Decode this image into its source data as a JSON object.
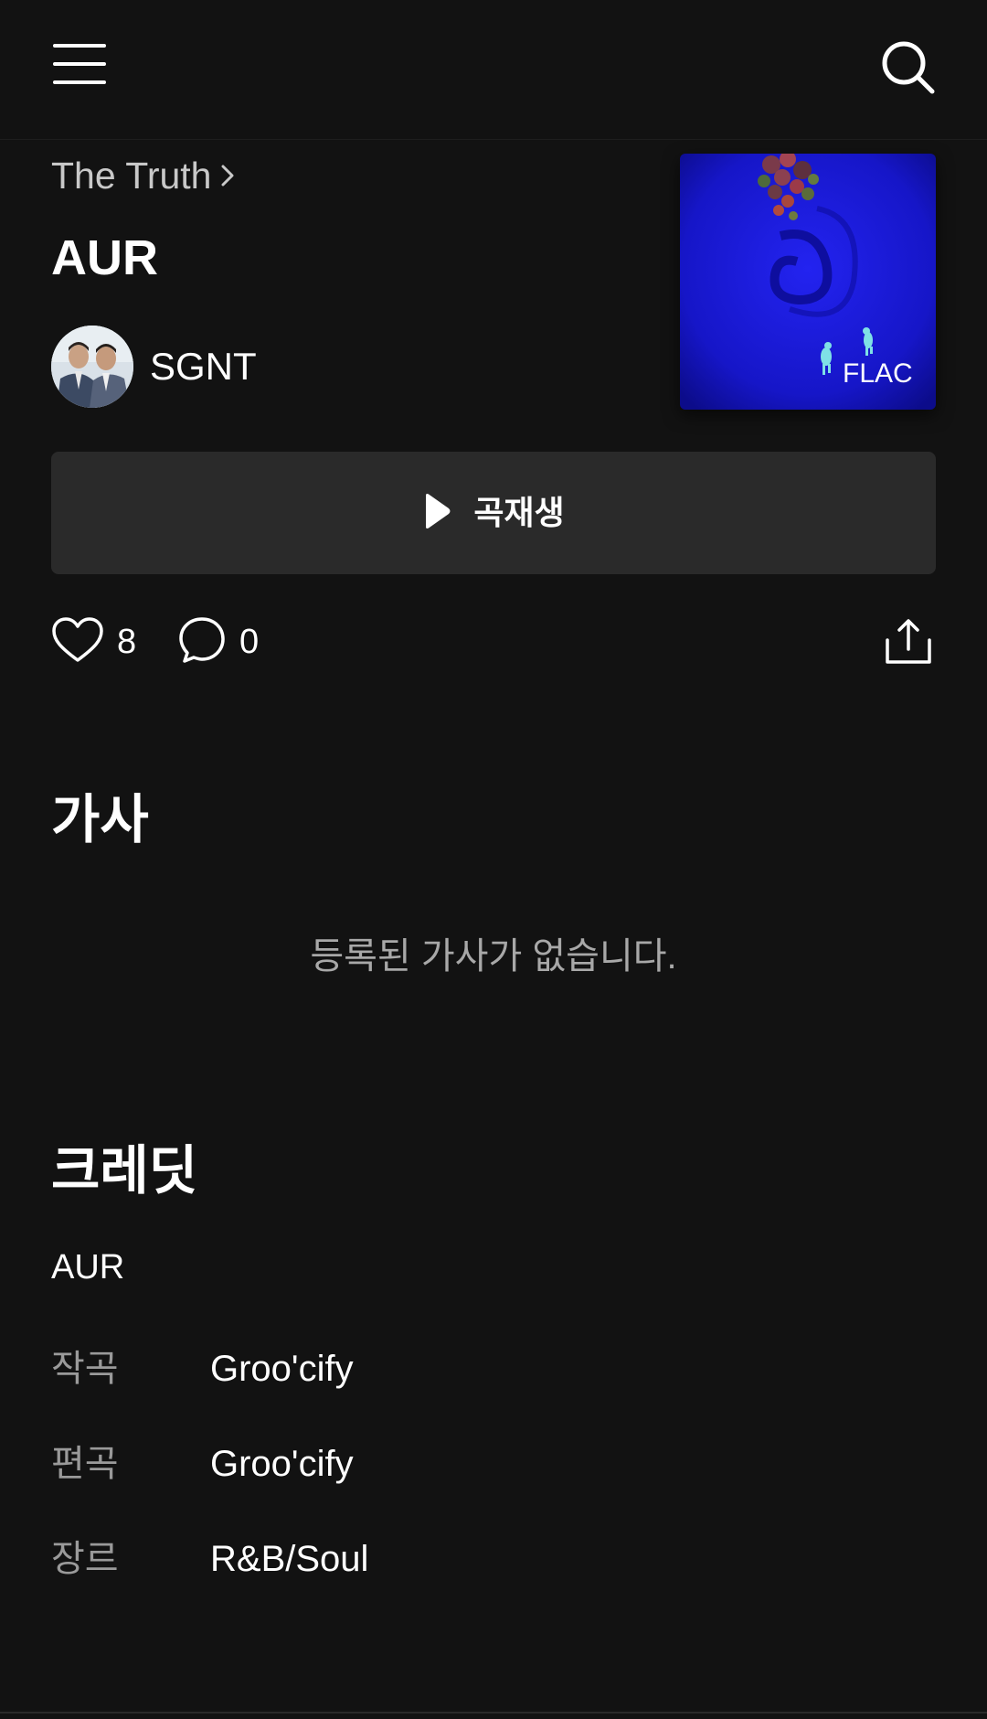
{
  "header": {
    "menu_icon": "hamburger-menu-icon",
    "search_icon": "search-icon"
  },
  "album": {
    "name": "The Truth"
  },
  "song": {
    "title": "AUR",
    "artist": "SGNT",
    "quality_badge": "FLAC"
  },
  "play_button": {
    "label": "곡재생"
  },
  "actions": {
    "likes": "8",
    "comments": "0"
  },
  "lyrics": {
    "heading": "가사",
    "empty_message": "등록된 가사가 없습니다."
  },
  "credits": {
    "heading": "크레딧",
    "song_title": "AUR",
    "rows": [
      {
        "key": "작곡",
        "value": "Groo'cify"
      },
      {
        "key": "편곡",
        "value": "Groo'cify"
      },
      {
        "key": "장르",
        "value": "R&B/Soul"
      }
    ]
  },
  "colors": {
    "background": "#121212",
    "button_background": "#2a2a2a",
    "secondary_text": "#a8a8a8",
    "album_art_blue": "#1616d8"
  }
}
